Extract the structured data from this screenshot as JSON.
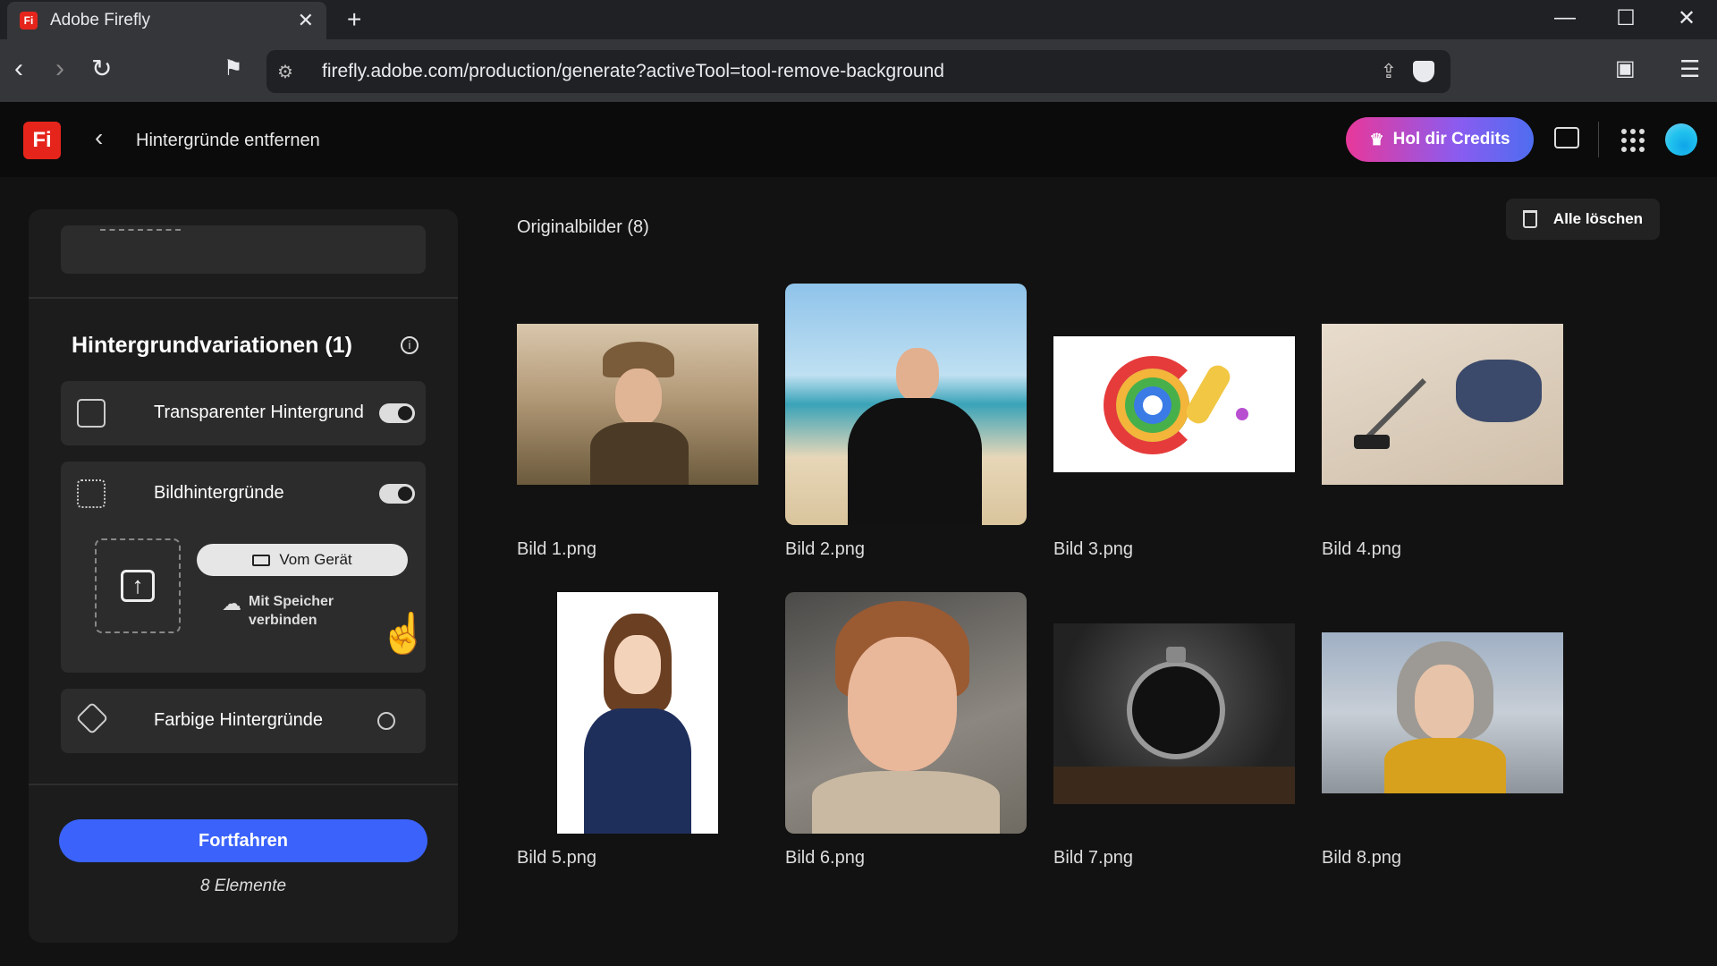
{
  "browser": {
    "tab_title": "Adobe Firefly",
    "tab_favicon": "Fi",
    "url": "firefly.adobe.com/production/generate?activeTool=tool-remove-background",
    "new_tab": "+",
    "close_tab": "✕"
  },
  "app": {
    "logo": "Fi",
    "page_title": "Hintergründe entfernen",
    "credits_button": "Hol dir Credits",
    "brand_color": "#e5251b"
  },
  "panel": {
    "variations_title": "Hintergrundvariationen (1)",
    "options": {
      "transparent": "Transparenter Hintergrund",
      "image_bg": "Bildhintergründe",
      "colored": "Farbige Hintergründe"
    },
    "device_button": "Vom Gerät",
    "cloud_link": "Mit Speicher verbinden",
    "continue_button": "Fortfahren",
    "elements_count": "8 Elemente",
    "accent_color": "#3b63fb"
  },
  "main": {
    "title": "Originalbilder (8)",
    "clear_button": "Alle löschen",
    "images": [
      {
        "label": "Bild 1.png"
      },
      {
        "label": "Bild 2.png"
      },
      {
        "label": "Bild 3.png"
      },
      {
        "label": "Bild 4.png"
      },
      {
        "label": "Bild 5.png"
      },
      {
        "label": "Bild 6.png"
      },
      {
        "label": "Bild 7.png"
      },
      {
        "label": "Bild 8.png"
      }
    ]
  }
}
